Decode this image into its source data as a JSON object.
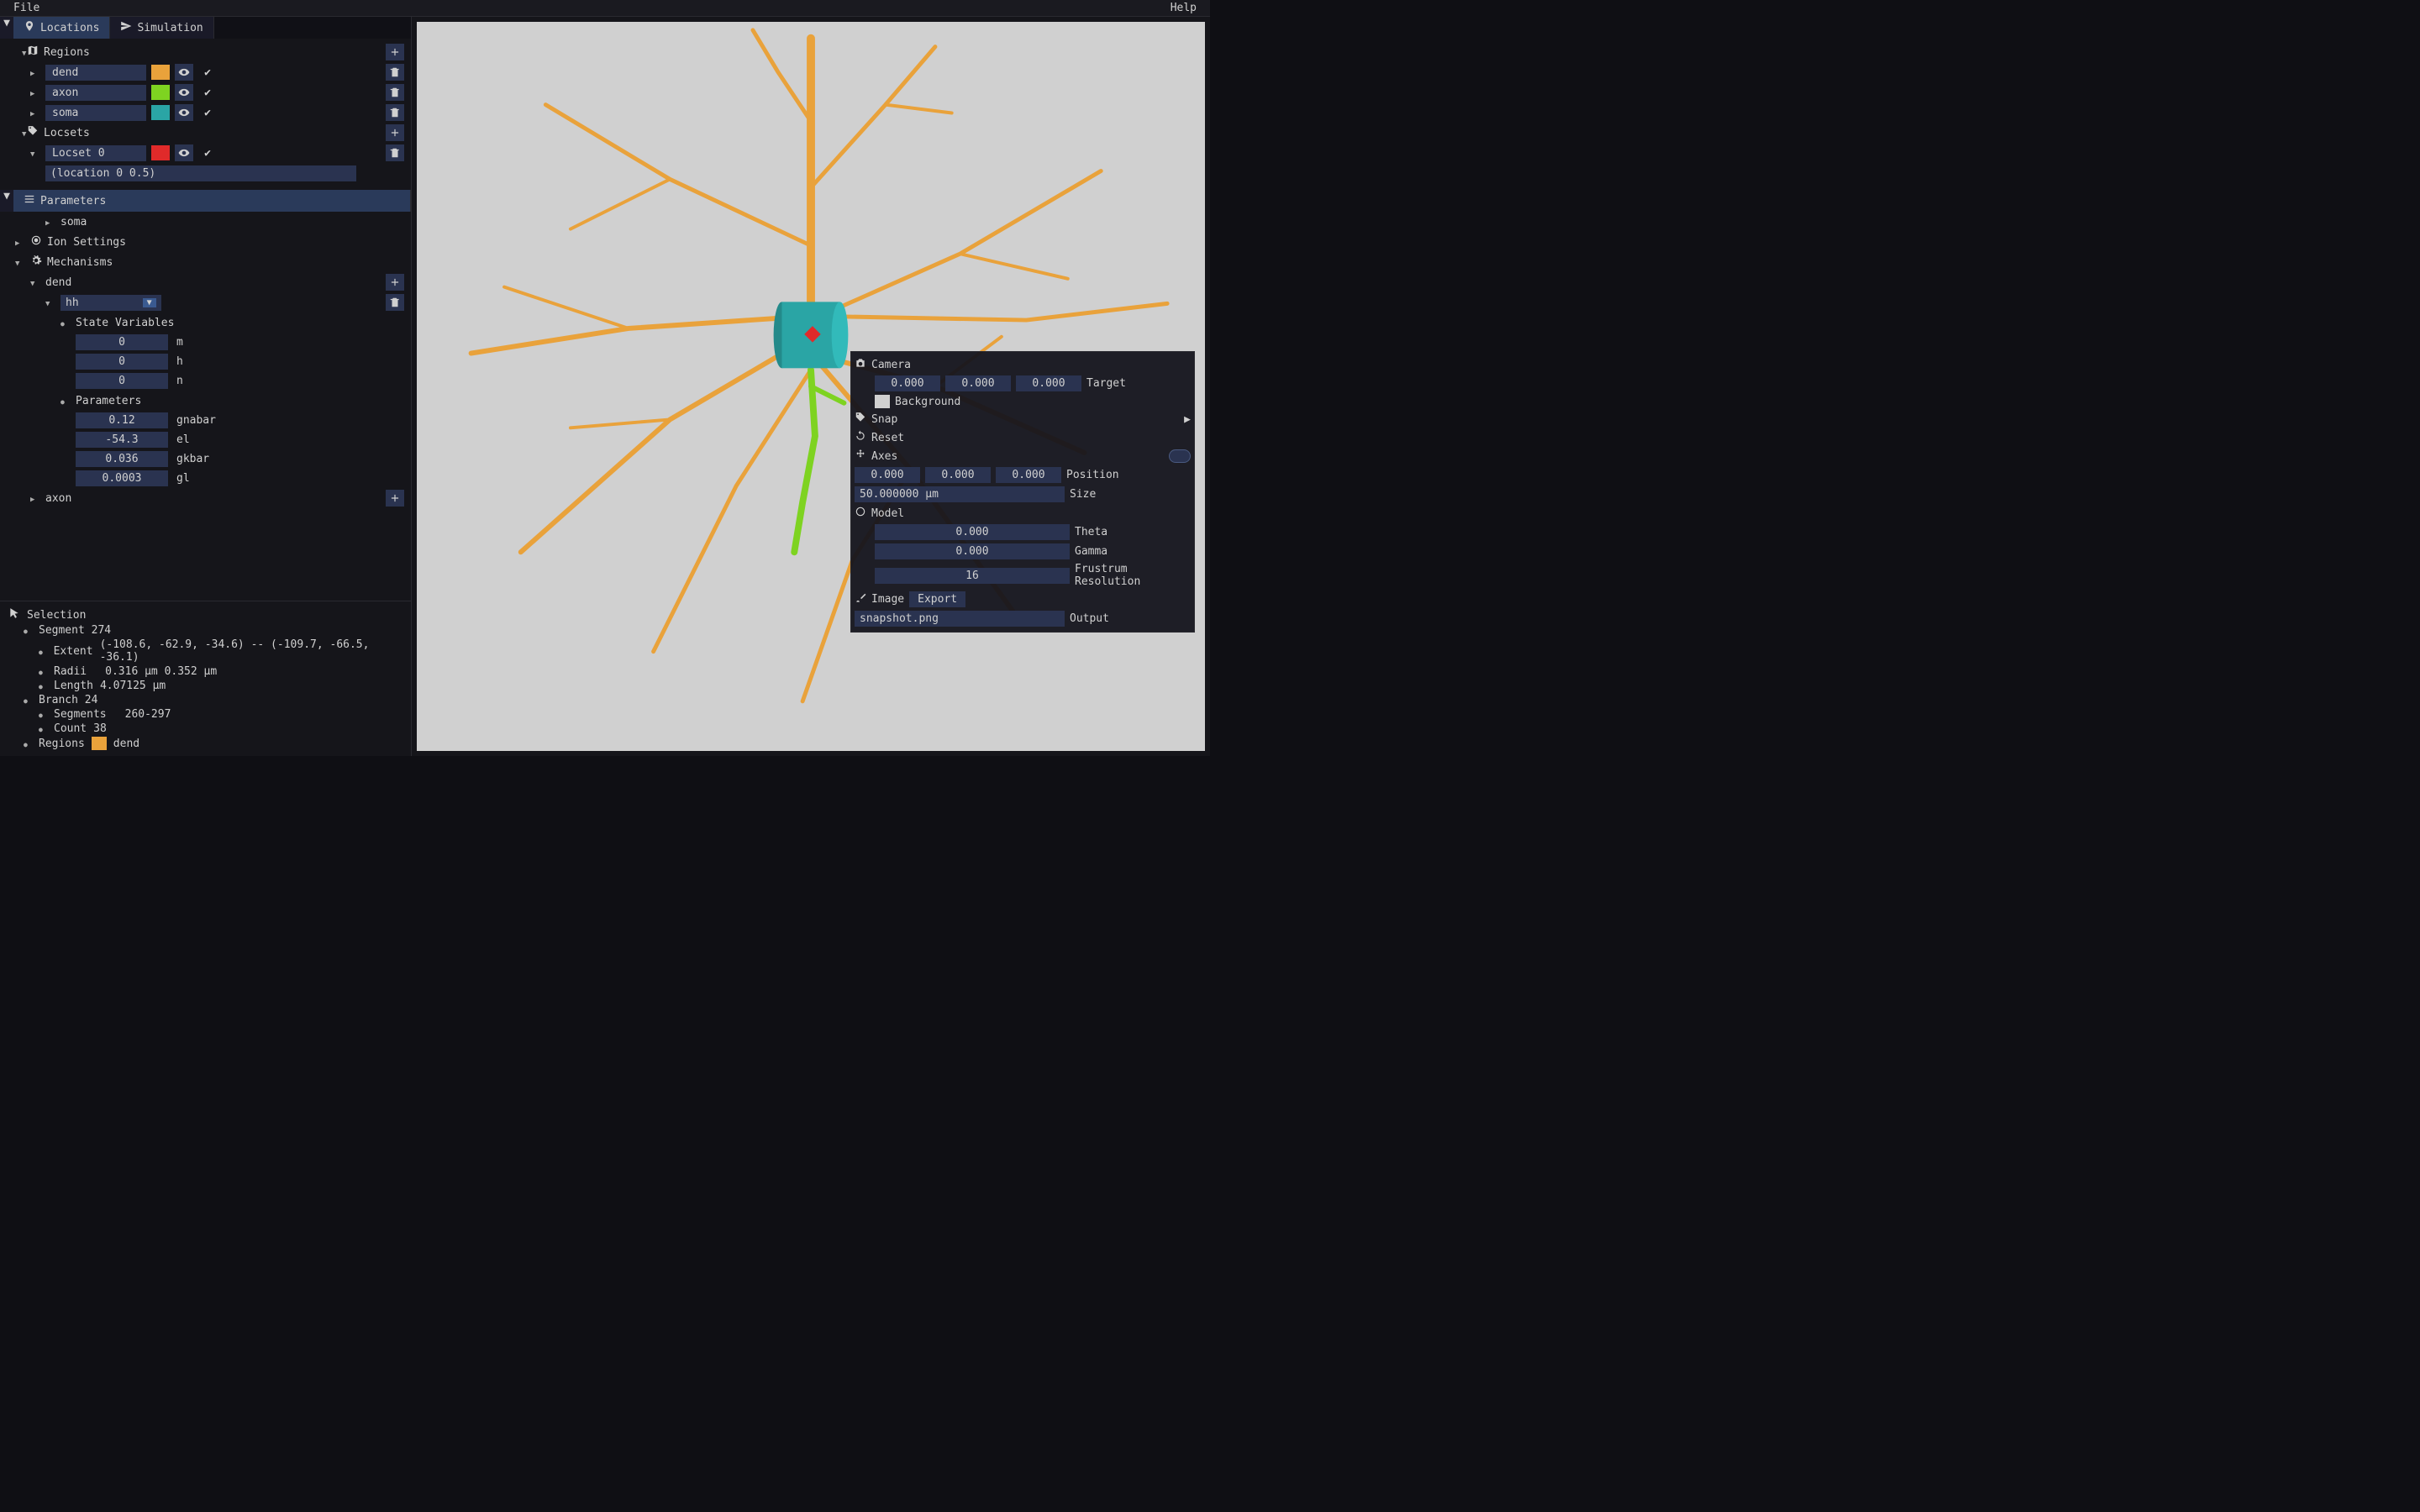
{
  "menubar": {
    "file": "File",
    "help": "Help"
  },
  "tabs": {
    "locations": "Locations",
    "simulation": "Simulation"
  },
  "locations": {
    "regions_header": "Regions",
    "regions": [
      {
        "name": "dend",
        "color": "#e9a23b"
      },
      {
        "name": "axon",
        "color": "#7ed321"
      },
      {
        "name": "soma",
        "color": "#2aa5a5"
      }
    ],
    "locsets_header": "Locsets",
    "locsets": [
      {
        "name": "Locset 0",
        "color": "#e02a2a",
        "expr": "(location 0 0.5)"
      }
    ]
  },
  "parameters": {
    "header": "Parameters",
    "soma_label": "soma",
    "ion_settings_label": "Ion Settings",
    "mechanisms_label": "Mechanisms",
    "dend_label": "dend",
    "mech_name": "hh",
    "state_vars_label": "State Variables",
    "state_vars": [
      {
        "value": "0",
        "name": "m"
      },
      {
        "value": "0",
        "name": "h"
      },
      {
        "value": "0",
        "name": "n"
      }
    ],
    "params_label": "Parameters",
    "params": [
      {
        "value": "0.12",
        "name": "gnabar"
      },
      {
        "value": "-54.3",
        "name": "el"
      },
      {
        "value": "0.036",
        "name": "gkbar"
      },
      {
        "value": "0.0003",
        "name": "gl"
      }
    ],
    "axon_label": "axon"
  },
  "selection": {
    "header": "Selection",
    "segment_label": "Segment 274",
    "extent_label": "Extent",
    "extent_value": "(-108.6, -62.9, -34.6) -- (-109.7, -66.5, -36.1)",
    "radii_label": "Radii",
    "radii_value": "0.316 μm 0.352 μm",
    "length_label": "Length",
    "length_value": "4.07125 μm",
    "branch_label": "Branch 24",
    "segments_label": "Segments",
    "segments_value": "260-297",
    "count_label": "Count",
    "count_value": "38",
    "regions_label": "Regions",
    "regions_color": "#e9a23b",
    "regions_value": "dend"
  },
  "camera": {
    "camera_label": "Camera",
    "target": [
      "0.000",
      "0.000",
      "0.000"
    ],
    "target_label": "Target",
    "background_label": "Background",
    "background_color": "#d0d0d0",
    "snap_label": "Snap",
    "reset_label": "Reset",
    "axes_label": "Axes",
    "position": [
      "0.000",
      "0.000",
      "0.000"
    ],
    "position_label": "Position",
    "size_value": "50.000000 μm",
    "size_label": "Size",
    "model_label": "Model",
    "theta_value": "0.000",
    "theta_label": "Theta",
    "gamma_value": "0.000",
    "gamma_label": "Gamma",
    "frustrum_value": "16",
    "frustrum_label": "Frustrum Resolution",
    "image_label": "Image",
    "export_label": "Export",
    "output_value": "snapshot.png",
    "output_label": "Output"
  },
  "colors": {
    "dend": "#e9a23b",
    "axon": "#7ed321",
    "soma": "#2aa5a5",
    "locset": "#e02a2a",
    "canvas_bg": "#d0d0d0"
  }
}
